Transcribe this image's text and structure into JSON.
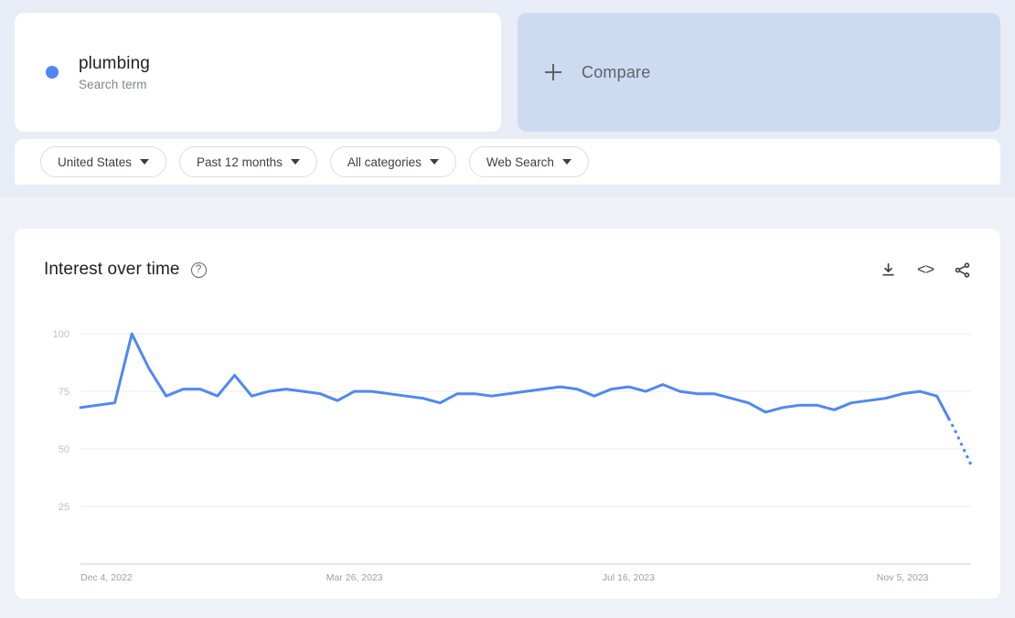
{
  "page": {
    "background_top": "#e8ecf6",
    "background_bottom": "#eef1f8",
    "accent_color": "#4e88f4"
  },
  "term_card": {
    "title": "plumbing",
    "subtitle": "Search term",
    "dot_color": "#4e88f4"
  },
  "compare_card": {
    "label": "Compare",
    "icon": "plus-icon",
    "background": "#ccdbf1"
  },
  "filters": [
    {
      "label": "United States",
      "icon": "chevron-down-icon"
    },
    {
      "label": "Past 12 months",
      "icon": "chevron-down-icon"
    },
    {
      "label": "All categories",
      "icon": "chevron-down-icon"
    },
    {
      "label": "Web Search",
      "icon": "chevron-down-icon"
    }
  ],
  "chart_card": {
    "title": "Interest over time",
    "help_icon": "help-circle-icon",
    "help_glyph": "?",
    "actions": [
      {
        "name": "download-icon",
        "glyph": ""
      },
      {
        "name": "embed-code-icon",
        "glyph": "<>"
      },
      {
        "name": "share-icon",
        "glyph": ""
      }
    ]
  },
  "chart_data": {
    "type": "line",
    "title": "Interest over time",
    "xlabel": "",
    "ylabel": "",
    "ylim": [
      0,
      110
    ],
    "yticks": [
      25,
      50,
      75,
      100
    ],
    "xticks": [
      "Dec 4, 2022",
      "Mar 26, 2023",
      "Jul 16, 2023",
      "Nov 5, 2023"
    ],
    "xtick_indices": [
      0,
      16,
      32,
      48
    ],
    "grid": true,
    "legend": false,
    "series": [
      {
        "name": "plumbing",
        "color": "#4e88f4",
        "values": [
          68,
          69,
          70,
          100,
          85,
          73,
          76,
          76,
          73,
          82,
          73,
          75,
          76,
          75,
          74,
          71,
          75,
          75,
          74,
          73,
          72,
          70,
          74,
          74,
          73,
          74,
          75,
          76,
          77,
          76,
          73,
          76,
          77,
          75,
          78,
          75,
          74,
          74,
          72,
          70,
          66,
          68,
          69,
          69,
          67,
          70,
          71,
          72,
          74,
          75,
          73,
          59,
          43
        ],
        "partial_from_index": 50,
        "partial_note": "final points shown as dotted partial-week data"
      }
    ]
  }
}
